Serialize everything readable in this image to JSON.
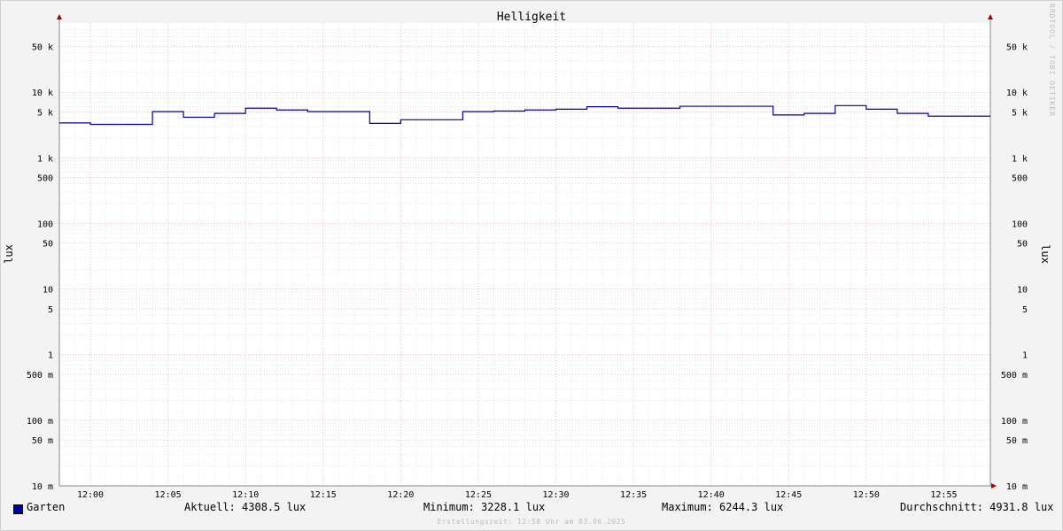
{
  "watermark": "RRDTOOL / TOBI OETIKER",
  "chart_data": {
    "type": "line",
    "title": "Helligkeit",
    "ylabel": "lux",
    "yscale": "log",
    "ylim": [
      0.01,
      100000
    ],
    "x_ticks": [
      "12:00",
      "12:05",
      "12:10",
      "12:15",
      "12:20",
      "12:25",
      "12:30",
      "12:35",
      "12:40",
      "12:45",
      "12:50",
      "12:55"
    ],
    "y_ticks": [
      {
        "value": 50000,
        "label": "50 k"
      },
      {
        "value": 10000,
        "label": "10 k"
      },
      {
        "value": 5000,
        "label": "5 k"
      },
      {
        "value": 1000,
        "label": "1 k"
      },
      {
        "value": 500,
        "label": "500"
      },
      {
        "value": 100,
        "label": "100"
      },
      {
        "value": 50,
        "label": "50"
      },
      {
        "value": 10,
        "label": "10"
      },
      {
        "value": 5,
        "label": "5"
      },
      {
        "value": 1,
        "label": "1"
      },
      {
        "value": 0.5,
        "label": "500 m"
      },
      {
        "value": 0.1,
        "label": "100 m"
      },
      {
        "value": 0.05,
        "label": "50 m"
      },
      {
        "value": 0.01,
        "label": "10 m"
      }
    ],
    "series": [
      {
        "name": "Garten",
        "color": "#0000a0",
        "steps": [
          {
            "x": "11:58",
            "y": 3400
          },
          {
            "x": "12:00",
            "y": 3230
          },
          {
            "x": "12:04",
            "y": 5050
          },
          {
            "x": "12:06",
            "y": 4150
          },
          {
            "x": "12:08",
            "y": 4750
          },
          {
            "x": "12:10",
            "y": 5700
          },
          {
            "x": "12:12",
            "y": 5350
          },
          {
            "x": "12:14",
            "y": 5050
          },
          {
            "x": "12:18",
            "y": 3350
          },
          {
            "x": "12:20",
            "y": 3800
          },
          {
            "x": "12:24",
            "y": 5050
          },
          {
            "x": "12:26",
            "y": 5150
          },
          {
            "x": "12:28",
            "y": 5350
          },
          {
            "x": "12:30",
            "y": 5500
          },
          {
            "x": "12:32",
            "y": 6000
          },
          {
            "x": "12:34",
            "y": 5700
          },
          {
            "x": "12:38",
            "y": 6100
          },
          {
            "x": "12:44",
            "y": 4500
          },
          {
            "x": "12:46",
            "y": 4750
          },
          {
            "x": "12:48",
            "y": 6244
          },
          {
            "x": "12:50",
            "y": 5500
          },
          {
            "x": "12:52",
            "y": 4750
          },
          {
            "x": "12:54",
            "y": 4308
          }
        ],
        "end_x": "12:58"
      }
    ]
  },
  "legend": {
    "name": "Garten",
    "color": "#0000a0",
    "current": "Aktuell: 4308.5 lux",
    "minimum": "Minimum: 3228.1 lux",
    "maximum": "Maximum: 6244.3 lux",
    "average": "Durchschnitt: 4931.8 lux"
  },
  "created": "Erstellungszeit: 12:58 Uhr am 03.06.2025"
}
